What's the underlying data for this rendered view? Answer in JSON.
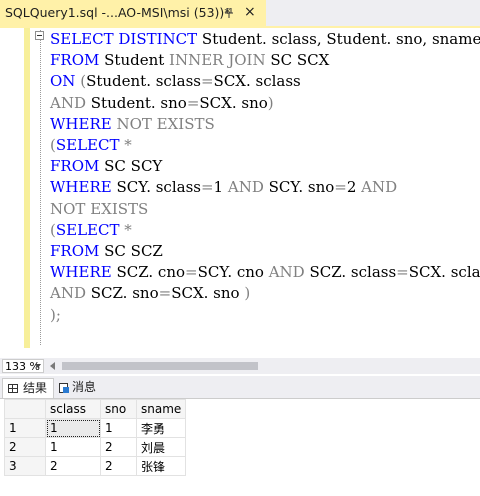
{
  "tab": {
    "title": "SQLQuery1.sql -...AO-MSI\\msi (53))*",
    "pin_icon": "pin-icon",
    "close_glyph": "×"
  },
  "editor": {
    "lines": [
      [
        [
          "kw",
          "SELECT DISTINCT "
        ],
        [
          "txt",
          "Student. sclass, Student. sno, sname"
        ]
      ],
      [
        [
          "kw",
          "FROM "
        ],
        [
          "txt",
          "Student "
        ],
        [
          "gray",
          "INNER JOIN "
        ],
        [
          "txt",
          "SC SCX"
        ]
      ],
      [
        [
          "kw",
          "ON "
        ],
        [
          "gray",
          "("
        ],
        [
          "txt",
          "Student. sclass"
        ],
        [
          "gray",
          "="
        ],
        [
          "txt",
          "SCX. sclass"
        ]
      ],
      [
        [
          "gray",
          "AND "
        ],
        [
          "txt",
          "Student. sno"
        ],
        [
          "gray",
          "="
        ],
        [
          "txt",
          "SCX. sno"
        ],
        [
          "gray",
          ")"
        ]
      ],
      [
        [
          "kw",
          "WHERE "
        ],
        [
          "gray",
          "NOT EXISTS"
        ]
      ],
      [
        [
          "gray",
          "("
        ],
        [
          "kw",
          "SELECT "
        ],
        [
          "gray",
          "*"
        ]
      ],
      [
        [
          "kw",
          "FROM "
        ],
        [
          "txt",
          "SC SCY"
        ]
      ],
      [
        [
          "kw",
          "WHERE "
        ],
        [
          "txt",
          "SCY. sclass"
        ],
        [
          "gray",
          "="
        ],
        [
          "txt",
          "1 "
        ],
        [
          "gray",
          "AND "
        ],
        [
          "txt",
          "SCY. sno"
        ],
        [
          "gray",
          "="
        ],
        [
          "txt",
          "2 "
        ],
        [
          "gray",
          "AND"
        ]
      ],
      [
        [
          "gray",
          "NOT EXISTS"
        ]
      ],
      [
        [
          "gray",
          "("
        ],
        [
          "kw",
          "SELECT "
        ],
        [
          "gray",
          "*"
        ]
      ],
      [
        [
          "kw",
          "FROM "
        ],
        [
          "txt",
          "SC SCZ"
        ]
      ],
      [
        [
          "kw",
          "WHERE "
        ],
        [
          "txt",
          "SCZ. cno"
        ],
        [
          "gray",
          "="
        ],
        [
          "txt",
          "SCY. cno "
        ],
        [
          "gray",
          "AND "
        ],
        [
          "txt",
          "SCZ. sclass"
        ],
        [
          "gray",
          "="
        ],
        [
          "txt",
          "SCX. sclass"
        ]
      ],
      [
        [
          "gray",
          "AND "
        ],
        [
          "txt",
          "SCZ. sno"
        ],
        [
          "gray",
          "="
        ],
        [
          "txt",
          "SCX. sno "
        ],
        [
          "gray",
          ")"
        ]
      ],
      [
        [
          "gray",
          ");"
        ]
      ]
    ]
  },
  "zoom": {
    "value": "133 %"
  },
  "results_tabs": {
    "results_label": "结果",
    "messages_label": "消息"
  },
  "results": {
    "columns": [
      "sclass",
      "sno",
      "sname"
    ],
    "rows": [
      {
        "num": "1",
        "cells": [
          "1",
          "1",
          "李勇"
        ]
      },
      {
        "num": "2",
        "cells": [
          "1",
          "2",
          "刘晨"
        ]
      },
      {
        "num": "3",
        "cells": [
          "2",
          "2",
          "张锋"
        ]
      }
    ]
  },
  "colors": {
    "keyword": "#0000ff",
    "operator": "#808080",
    "tab_active": "#fff1a8"
  }
}
